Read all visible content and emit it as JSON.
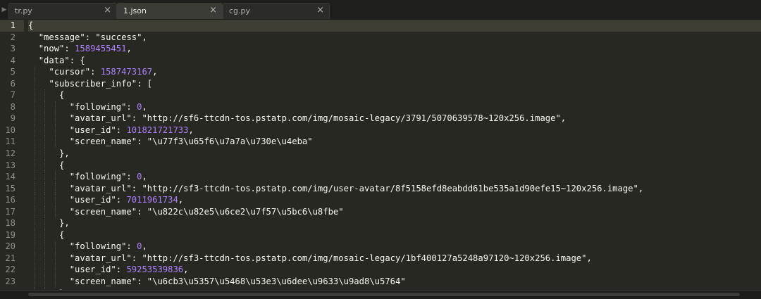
{
  "tabs": [
    {
      "label": "tr.py",
      "close": "×",
      "active": false
    },
    {
      "label": "1.json",
      "close": "×",
      "active": true
    },
    {
      "label": "cg.py",
      "close": "×",
      "active": false
    }
  ],
  "nav_arrow": "▶",
  "current_line": 1,
  "code_lines": [
    [
      {
        "t": "{",
        "c": "punc"
      }
    ],
    [
      {
        "t": "  ",
        "c": "punc"
      },
      {
        "t": "\"message\"",
        "c": "str"
      },
      {
        "t": ": ",
        "c": "punc"
      },
      {
        "t": "\"success\"",
        "c": "str"
      },
      {
        "t": ",",
        "c": "punc"
      }
    ],
    [
      {
        "t": "  ",
        "c": "punc"
      },
      {
        "t": "\"now\"",
        "c": "str"
      },
      {
        "t": ": ",
        "c": "punc"
      },
      {
        "t": "1589455451",
        "c": "num"
      },
      {
        "t": ",",
        "c": "punc"
      }
    ],
    [
      {
        "t": "  ",
        "c": "punc"
      },
      {
        "t": "\"data\"",
        "c": "str"
      },
      {
        "t": ": {",
        "c": "punc"
      }
    ],
    [
      {
        "t": "    ",
        "c": "punc"
      },
      {
        "t": "\"cursor\"",
        "c": "str"
      },
      {
        "t": ": ",
        "c": "punc"
      },
      {
        "t": "1587473167",
        "c": "num"
      },
      {
        "t": ",",
        "c": "punc"
      }
    ],
    [
      {
        "t": "    ",
        "c": "punc"
      },
      {
        "t": "\"subscriber_info\"",
        "c": "str"
      },
      {
        "t": ": [",
        "c": "punc"
      }
    ],
    [
      {
        "t": "      {",
        "c": "punc"
      }
    ],
    [
      {
        "t": "        ",
        "c": "punc"
      },
      {
        "t": "\"following\"",
        "c": "str"
      },
      {
        "t": ": ",
        "c": "punc"
      },
      {
        "t": "0",
        "c": "num"
      },
      {
        "t": ",",
        "c": "punc"
      }
    ],
    [
      {
        "t": "        ",
        "c": "punc"
      },
      {
        "t": "\"avatar_url\"",
        "c": "str"
      },
      {
        "t": ": ",
        "c": "punc"
      },
      {
        "t": "\"http://sf6-ttcdn-tos.pstatp.com/img/mosaic-legacy/3791/5070639578~120x256.image\"",
        "c": "str"
      },
      {
        "t": ",",
        "c": "punc"
      }
    ],
    [
      {
        "t": "        ",
        "c": "punc"
      },
      {
        "t": "\"user_id\"",
        "c": "str"
      },
      {
        "t": ": ",
        "c": "punc"
      },
      {
        "t": "101821721733",
        "c": "num"
      },
      {
        "t": ",",
        "c": "punc"
      }
    ],
    [
      {
        "t": "        ",
        "c": "punc"
      },
      {
        "t": "\"screen_name\"",
        "c": "str"
      },
      {
        "t": ": ",
        "c": "punc"
      },
      {
        "t": "\"\\u77f3\\u65f6\\u7a7a\\u730e\\u4eba\"",
        "c": "str"
      }
    ],
    [
      {
        "t": "      },",
        "c": "punc"
      }
    ],
    [
      {
        "t": "      {",
        "c": "punc"
      }
    ],
    [
      {
        "t": "        ",
        "c": "punc"
      },
      {
        "t": "\"following\"",
        "c": "str"
      },
      {
        "t": ": ",
        "c": "punc"
      },
      {
        "t": "0",
        "c": "num"
      },
      {
        "t": ",",
        "c": "punc"
      }
    ],
    [
      {
        "t": "        ",
        "c": "punc"
      },
      {
        "t": "\"avatar_url\"",
        "c": "str"
      },
      {
        "t": ": ",
        "c": "punc"
      },
      {
        "t": "\"http://sf3-ttcdn-tos.pstatp.com/img/user-avatar/8f5158efd8eabdd61be535a1d90efe15~120x256.image\"",
        "c": "str"
      },
      {
        "t": ",",
        "c": "punc"
      }
    ],
    [
      {
        "t": "        ",
        "c": "punc"
      },
      {
        "t": "\"user_id\"",
        "c": "str"
      },
      {
        "t": ": ",
        "c": "punc"
      },
      {
        "t": "7011961734",
        "c": "num"
      },
      {
        "t": ",",
        "c": "punc"
      }
    ],
    [
      {
        "t": "        ",
        "c": "punc"
      },
      {
        "t": "\"screen_name\"",
        "c": "str"
      },
      {
        "t": ": ",
        "c": "punc"
      },
      {
        "t": "\"\\u822c\\u82e5\\u6ce2\\u7f57\\u5bc6\\u8fbe\"",
        "c": "str"
      }
    ],
    [
      {
        "t": "      },",
        "c": "punc"
      }
    ],
    [
      {
        "t": "      {",
        "c": "punc"
      }
    ],
    [
      {
        "t": "        ",
        "c": "punc"
      },
      {
        "t": "\"following\"",
        "c": "str"
      },
      {
        "t": ": ",
        "c": "punc"
      },
      {
        "t": "0",
        "c": "num"
      },
      {
        "t": ",",
        "c": "punc"
      }
    ],
    [
      {
        "t": "        ",
        "c": "punc"
      },
      {
        "t": "\"avatar_url\"",
        "c": "str"
      },
      {
        "t": ": ",
        "c": "punc"
      },
      {
        "t": "\"http://sf3-ttcdn-tos.pstatp.com/img/mosaic-legacy/1bf400127a5248a97120~120x256.image\"",
        "c": "str"
      },
      {
        "t": ",",
        "c": "punc"
      }
    ],
    [
      {
        "t": "        ",
        "c": "punc"
      },
      {
        "t": "\"user_id\"",
        "c": "str"
      },
      {
        "t": ": ",
        "c": "punc"
      },
      {
        "t": "59253539836",
        "c": "num"
      },
      {
        "t": ",",
        "c": "punc"
      }
    ],
    [
      {
        "t": "        ",
        "c": "punc"
      },
      {
        "t": "\"screen_name\"",
        "c": "str"
      },
      {
        "t": ": ",
        "c": "punc"
      },
      {
        "t": "\"\\u6cb3\\u5357\\u5468\\u53e3\\u6dee\\u9633\\u9ad8\\u5764\"",
        "c": "str"
      }
    ],
    [
      {
        "t": "      }",
        "c": "punc"
      }
    ]
  ],
  "colors": {
    "background": "#272822",
    "number": "#ae81ff",
    "string": "#f8f8f2",
    "gutter_text": "#8f908a"
  }
}
